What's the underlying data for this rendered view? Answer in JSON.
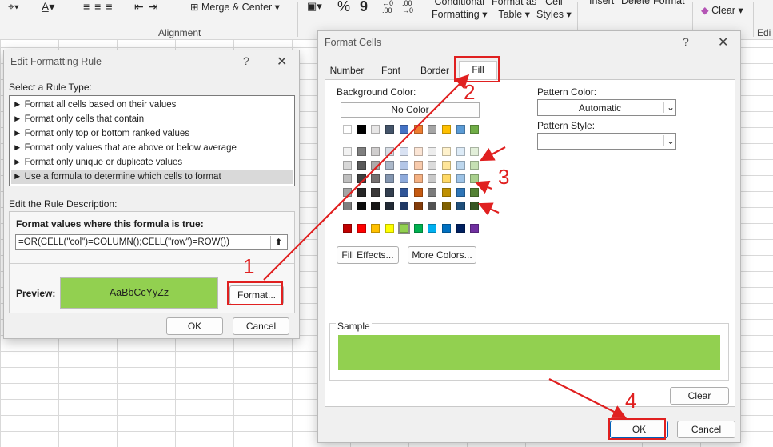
{
  "ribbon": {
    "merge_center": "Merge & Center",
    "alignment_group": "Alignment",
    "conditional_formatting_line1": "Conditional",
    "conditional_formatting_line2": "Formatting",
    "format_as_table_line1": "Format as",
    "format_as_table_line2": "Table",
    "cell_styles_line1": "Cell",
    "cell_styles_line2": "Styles",
    "insert": "Insert",
    "delete": "Delete",
    "format": "Format",
    "clear": "Clear",
    "edit_group": "Edi",
    "percent": "%",
    "comma": "9"
  },
  "edit_rule": {
    "title": "Edit Formatting Rule",
    "help": "?",
    "close": "✕",
    "select_rule_type_label": "Select a Rule Type:",
    "rule_types": [
      "► Format all cells based on their values",
      "► Format only cells that contain",
      "► Format only top or bottom ranked values",
      "► Format only values that are above or below average",
      "► Format only unique or duplicate values",
      "► Use a formula to determine which cells to format"
    ],
    "selected_index": 5,
    "edit_description_label": "Edit the Rule Description:",
    "formula_label": "Format values where this formula is true:",
    "formula_value": "=OR(CELL(\"col\")=COLUMN();CELL(\"row\")=ROW())",
    "preview_label": "Preview:",
    "preview_text": "AaBbCcYyZz",
    "preview_color": "#92d050",
    "format_button": "Format...",
    "ok": "OK",
    "cancel": "Cancel"
  },
  "format_cells": {
    "title": "Format Cells",
    "help": "?",
    "close": "✕",
    "tabs": [
      "Number",
      "Font",
      "Border",
      "Fill"
    ],
    "active_tab": "Fill",
    "background_color_label": "Background Color:",
    "no_color": "No Color",
    "pattern_color_label": "Pattern Color:",
    "pattern_color_value": "Automatic",
    "pattern_style_label": "Pattern Style:",
    "fill_effects": "Fill Effects...",
    "more_colors": "More Colors...",
    "sample_label": "Sample",
    "sample_color": "#92d050",
    "clear": "Clear",
    "ok": "OK",
    "cancel": "Cancel",
    "theme_row": [
      "#ffffff",
      "#000000",
      "#e7e6e6",
      "#44546a",
      "#4472c4",
      "#ed7d31",
      "#a5a5a5",
      "#ffc000",
      "#5b9bd5",
      "#70ad47"
    ],
    "tint_rows": [
      [
        "#f2f2f2",
        "#7f7f7f",
        "#d0cece",
        "#d6dce4",
        "#d9e2f3",
        "#fbe5d5",
        "#ededed",
        "#fff2cc",
        "#ddebf7",
        "#e2efd9"
      ],
      [
        "#d8d8d8",
        "#595959",
        "#aeaaaa",
        "#acb9ca",
        "#b4c6e7",
        "#f8cbad",
        "#dbdbdb",
        "#ffe699",
        "#bdd7ee",
        "#c5e0b3"
      ],
      [
        "#bfbfbf",
        "#3f3f3f",
        "#757070",
        "#8496b0",
        "#8eaadb",
        "#f4b183",
        "#c9c9c9",
        "#ffd966",
        "#9dc3e6",
        "#a9d08e"
      ],
      [
        "#a5a5a5",
        "#262626",
        "#3a3838",
        "#333f4f",
        "#2f5496",
        "#c55a11",
        "#7b7b7b",
        "#bf9000",
        "#2e75b6",
        "#548235"
      ],
      [
        "#7f7f7f",
        "#0c0c0c",
        "#171616",
        "#222a35",
        "#1f3864",
        "#833c0b",
        "#525252",
        "#7f6000",
        "#1f4e79",
        "#375623"
      ]
    ],
    "standard_row": [
      "#c00000",
      "#ff0000",
      "#ffc000",
      "#ffff00",
      "#92d050",
      "#00b050",
      "#00b0f0",
      "#0070c0",
      "#002060",
      "#7030a0"
    ]
  },
  "callouts": [
    "1",
    "2",
    "3",
    "4"
  ],
  "colors": {
    "annotation": "#e02020",
    "accent_green": "#92d050"
  }
}
